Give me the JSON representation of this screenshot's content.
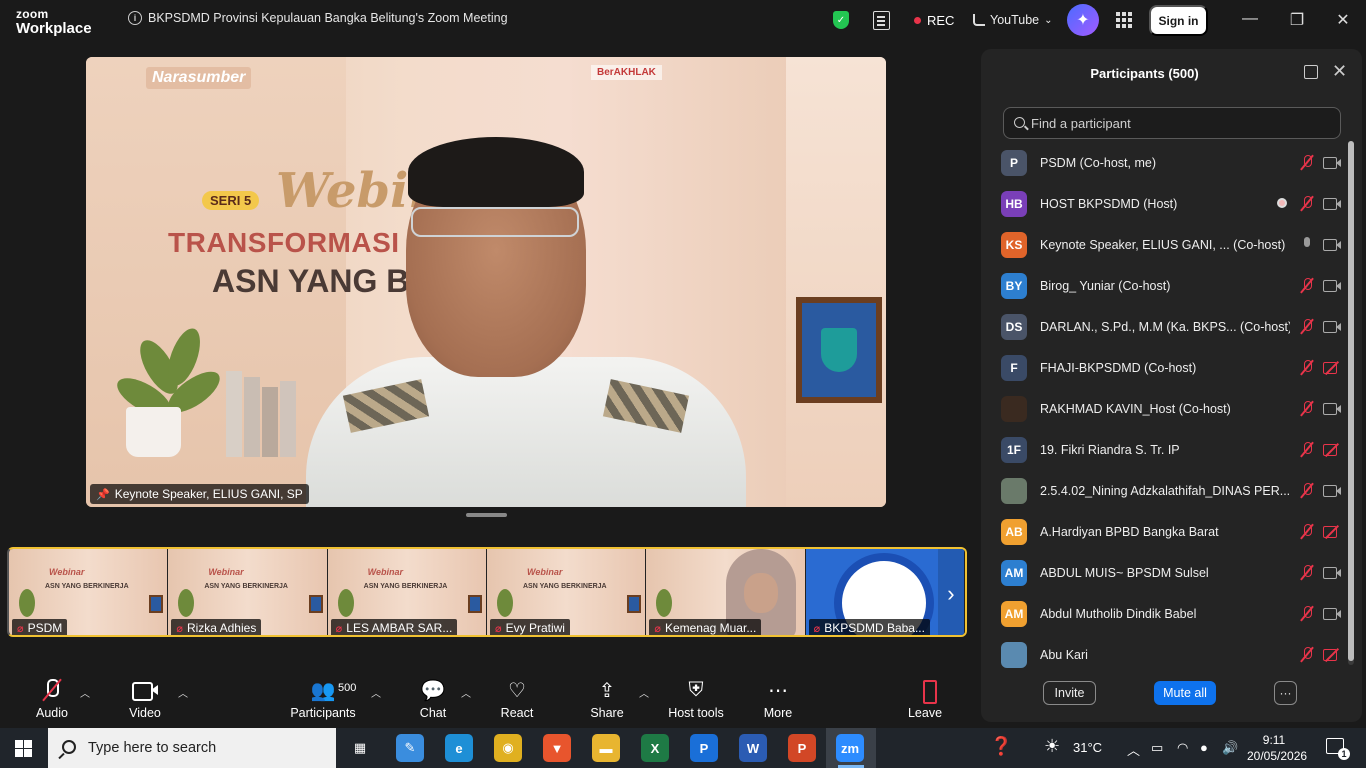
{
  "app": {
    "brand_line1": "zoom",
    "brand_line2": "Workplace",
    "meeting_title": "BKPSDMD Provinsi Kepulauan Bangka Belitung's Zoom Meeting",
    "rec_label": "REC",
    "stream_label": "YouTube",
    "sign_in_label": "Sign in"
  },
  "main_video": {
    "speaker_label": "Keynote Speaker, ELIUS GANI, SP",
    "bg_banner": "Narasumber",
    "bg_logo": "BerAKHLAK",
    "bg_seri": "SERI 5",
    "bg_webinar": "Webin",
    "bg_line1": "TRANSFORMASI BU",
    "bg_line2": "ASN YANG BERI"
  },
  "gallery": {
    "tiles": [
      {
        "name": "PSDM",
        "mini_title": "Webinar",
        "mini_sub": "ASN YANG BERKINERJA"
      },
      {
        "name": "Rizka Adhies",
        "mini_title": "Webinar",
        "mini_sub": "ASN YANG BERKINERJA"
      },
      {
        "name": "LES AMBAR SAR...",
        "mini_title": "Webinar",
        "mini_sub": "ASN YANG BERKINERJA"
      },
      {
        "name": "Evy Pratiwi",
        "mini_title": "Webinar",
        "mini_sub": "ASN YANG BERKINERJA"
      },
      {
        "name": "Kemenag Muar..."
      },
      {
        "name": "BKPSDMD Baba..."
      }
    ],
    "next_glyph": "›"
  },
  "participants": {
    "title": "Participants (500)",
    "search_placeholder": "Find a participant",
    "list": [
      {
        "initials": "P",
        "color": "#4a5468",
        "name": "PSDM (Co-host, me)",
        "mic": "muted",
        "cam": "on"
      },
      {
        "initials": "HB",
        "color": "#7a3fb8",
        "name": "HOST BKPSDMD (Host)",
        "mic": "muted",
        "cam": "on",
        "rec": true
      },
      {
        "initials": "KS",
        "color": "#e0642a",
        "name": "Keynote Speaker, ELIUS GANI, ...  (Co-host)",
        "mic": "on",
        "cam": "on"
      },
      {
        "initials": "BY",
        "color": "#2d7fd0",
        "name": "Birog_ Yuniar (Co-host)",
        "mic": "muted",
        "cam": "on"
      },
      {
        "initials": "DS",
        "color": "#4a5468",
        "name": "DARLAN., S.Pd., M.M (Ka. BKPS...  (Co-host)",
        "mic": "muted",
        "cam": "on"
      },
      {
        "initials": "F",
        "color": "#3a4a66",
        "name": "FHAJI-BKPSDMD (Co-host)",
        "mic": "muted",
        "cam": "off"
      },
      {
        "initials": "",
        "color": "#3a2a20",
        "name": "RAKHMAD KAVIN_Host (Co-host)",
        "mic": "muted",
        "cam": "on"
      },
      {
        "initials": "1F",
        "color": "#3a4a66",
        "name": "19. Fikri Riandra S. Tr. IP",
        "mic": "muted",
        "cam": "off"
      },
      {
        "initials": "",
        "color": "#6a7a6a",
        "name": "2.5.4.02_Nining Adzkalathifah_DINAS PER...",
        "mic": "muted",
        "cam": "on"
      },
      {
        "initials": "AB",
        "color": "#f0a030",
        "name": "A.Hardiyan BPBD Bangka Barat",
        "mic": "muted",
        "cam": "off"
      },
      {
        "initials": "AM",
        "color": "#2d7fd0",
        "name": "ABDUL MUIS~ BPSDM Sulsel",
        "mic": "muted",
        "cam": "on"
      },
      {
        "initials": "AM",
        "color": "#f0a030",
        "name": "Abdul Mutholib Dindik Babel",
        "mic": "muted",
        "cam": "on"
      },
      {
        "initials": "",
        "color": "#5a8ab0",
        "name": "Abu Kari",
        "mic": "muted",
        "cam": "off"
      }
    ],
    "invite_label": "Invite",
    "mute_all_label": "Mute all",
    "more_label": "···"
  },
  "toolbar": {
    "audio": "Audio",
    "video": "Video",
    "participants": "Participants",
    "participants_count": "500",
    "chat": "Chat",
    "react": "React",
    "share": "Share",
    "host_tools": "Host tools",
    "more": "More",
    "leave": "Leave"
  },
  "taskbar": {
    "search_placeholder": "Type here to search",
    "weather": "31°C",
    "time": "9:11",
    "date": "20/05/2026",
    "notif_count": "1",
    "apps": [
      {
        "name": "task-view-icon",
        "glyph": "▦",
        "color": "transparent"
      },
      {
        "name": "paint-icon",
        "glyph": "✎",
        "color": "#3a8dde"
      },
      {
        "name": "edge-icon",
        "glyph": "e",
        "color": "#1e8fd6"
      },
      {
        "name": "chrome-icon",
        "glyph": "◉",
        "color": "#e0b020"
      },
      {
        "name": "brave-icon",
        "glyph": "▼",
        "color": "#e8552d"
      },
      {
        "name": "file-explorer-icon",
        "glyph": "▬",
        "color": "#e8b530"
      },
      {
        "name": "excel-icon",
        "glyph": "X",
        "color": "#1e7a45"
      },
      {
        "name": "publisher-icon",
        "glyph": "P",
        "color": "#1a6fd8"
      },
      {
        "name": "word-icon",
        "glyph": "W",
        "color": "#2b5cb3"
      },
      {
        "name": "powerpoint-icon",
        "glyph": "P",
        "color": "#d24726"
      },
      {
        "name": "zoom-icon",
        "glyph": "zm",
        "color": "#2d8cff"
      }
    ]
  }
}
